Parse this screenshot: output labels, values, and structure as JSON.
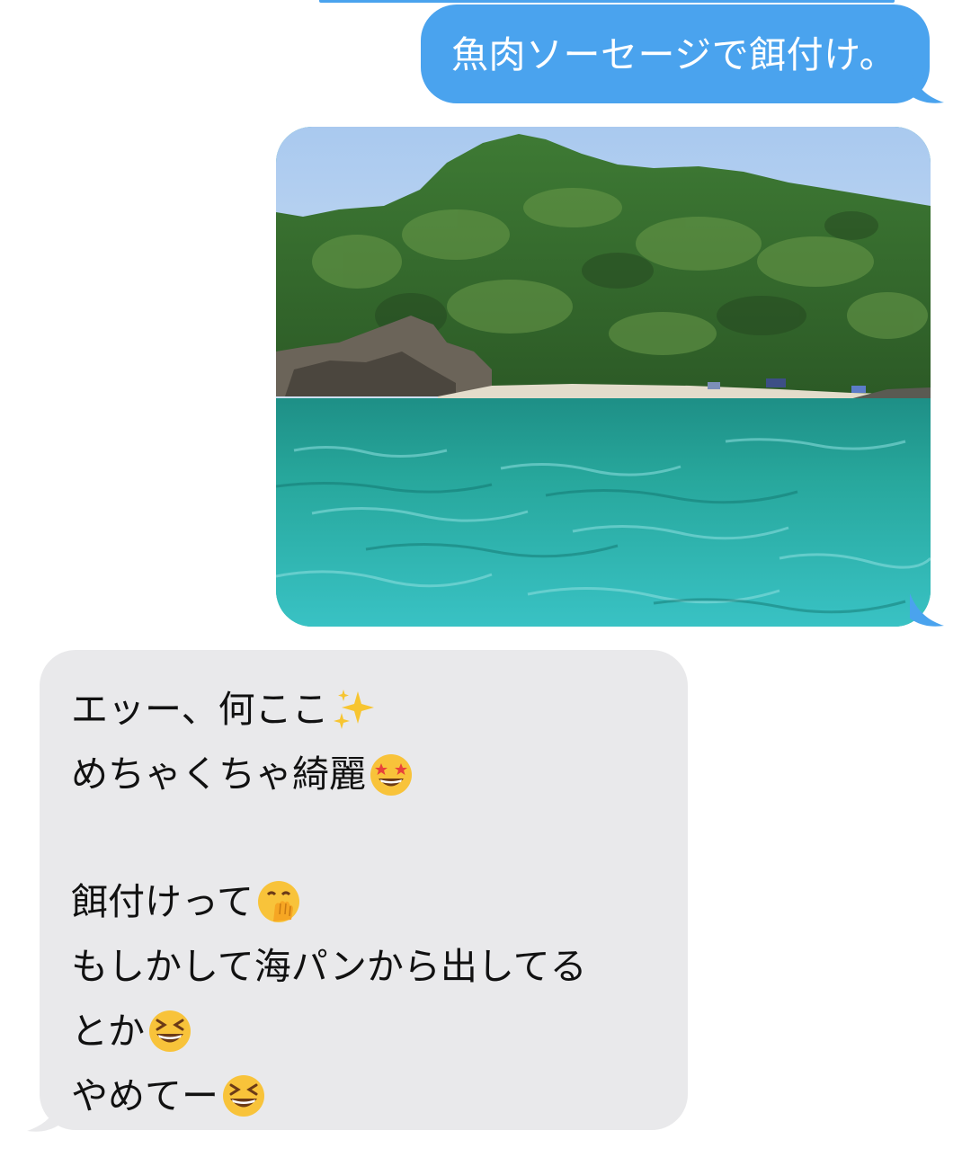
{
  "conversation": {
    "sent_text": "魚肉ソーセージで餌付け。",
    "sent_photo": {
      "description_icon": "photo-beach-cove"
    },
    "received_lines": [
      {
        "text": "エッー、何ここ",
        "emoji": "sparkles-icon"
      },
      {
        "text": "めちゃくちゃ綺麗",
        "emoji": "star-struck-emoji-icon"
      },
      {
        "text": "",
        "emoji": null
      },
      {
        "text": "餌付けって",
        "emoji": "hand-over-mouth-emoji-icon"
      },
      {
        "text": "もしかして海パンから出してる",
        "emoji": null
      },
      {
        "text": "とか",
        "emoji": "grinning-squinting-emoji-icon"
      },
      {
        "text": "やめてー",
        "emoji": "grinning-squinting-emoji-icon"
      }
    ]
  },
  "colors": {
    "sent_bubble": "#4aa3ee",
    "received_bubble": "#e9e9eb",
    "received_text": "#111111",
    "sent_text": "#ffffff"
  }
}
